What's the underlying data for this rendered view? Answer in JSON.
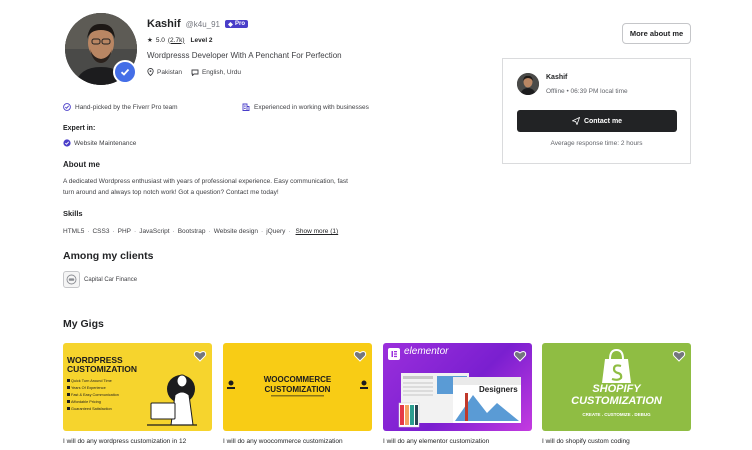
{
  "profile": {
    "name": "Kashif",
    "username": "@k4u_91",
    "pro_label": "Pro",
    "rating": "5.0",
    "rating_count": "(2.7k)",
    "level": "Level 2",
    "tagline": "Wordpresss Developer With A Penchant For Perfection",
    "country": "Pakistan",
    "languages": "English, Urdu"
  },
  "header": {
    "more_about_label": "More about me"
  },
  "contact_card": {
    "name": "Kashif",
    "status": "Offline • 06:39 PM local time",
    "contact_label": "Contact me",
    "response_time": "Average response time: 2 hours"
  },
  "features": [
    {
      "label": "Hand-picked by the Fiverr Pro team",
      "icon": "check-circle-icon"
    },
    {
      "label": "Experienced in working with businesses",
      "icon": "building-icon"
    }
  ],
  "expert": {
    "title": "Expert in:",
    "items": [
      "Website Maintenance"
    ]
  },
  "about": {
    "title": "About me",
    "line1": "A dedicated Wordpress enthusiast with years of professional experience. Easy communication, fast",
    "line2": "turn around and always top notch work! Got a question? Contact me today!"
  },
  "skills": {
    "title": "Skills",
    "items": [
      "HTML5",
      "CSS3",
      "PHP",
      "JavaScript",
      "Bootstrap",
      "Website design",
      "jQuery"
    ],
    "show_more": "Show more (1)"
  },
  "clients": {
    "title": "Among my clients",
    "items": [
      "Capital Car Finance"
    ]
  },
  "gigs": {
    "title": "My Gigs",
    "items": [
      {
        "title": "I will do any wordpress customization in 12",
        "image_heading": "WORDPRESS CUSTOMIZATION",
        "bullets": [
          "Quick Turn Around Time",
          "Years Of Experience",
          "Fast & Easy Communication",
          "Affordable Pricing",
          "Guaranteed Satisfaction"
        ]
      },
      {
        "title": "I will do any woocommerce customization",
        "image_heading_1": "WOOCOMMERCE",
        "image_heading_2": "CUSTOMIZATION"
      },
      {
        "title": "I will do any elementor customization",
        "image_brand": "elementor",
        "image_label": "Designers"
      },
      {
        "title": "I will do shopify custom coding",
        "image_heading_1": "SHOPIFY",
        "image_heading_2": "CUSTOMIZATION",
        "image_sub": "CREATE . CUSTOMIZE . DEBUG"
      }
    ]
  },
  "colors": {
    "pro_badge": "#4a3ec9",
    "verified": "#446ee7",
    "contact_button": "#222325",
    "wordpress_yellow": "#f6d42d",
    "woocommerce_yellow": "#f8cc15",
    "elementor_purple": "#8f2fd9",
    "shopify_green": "#8fbd43"
  }
}
